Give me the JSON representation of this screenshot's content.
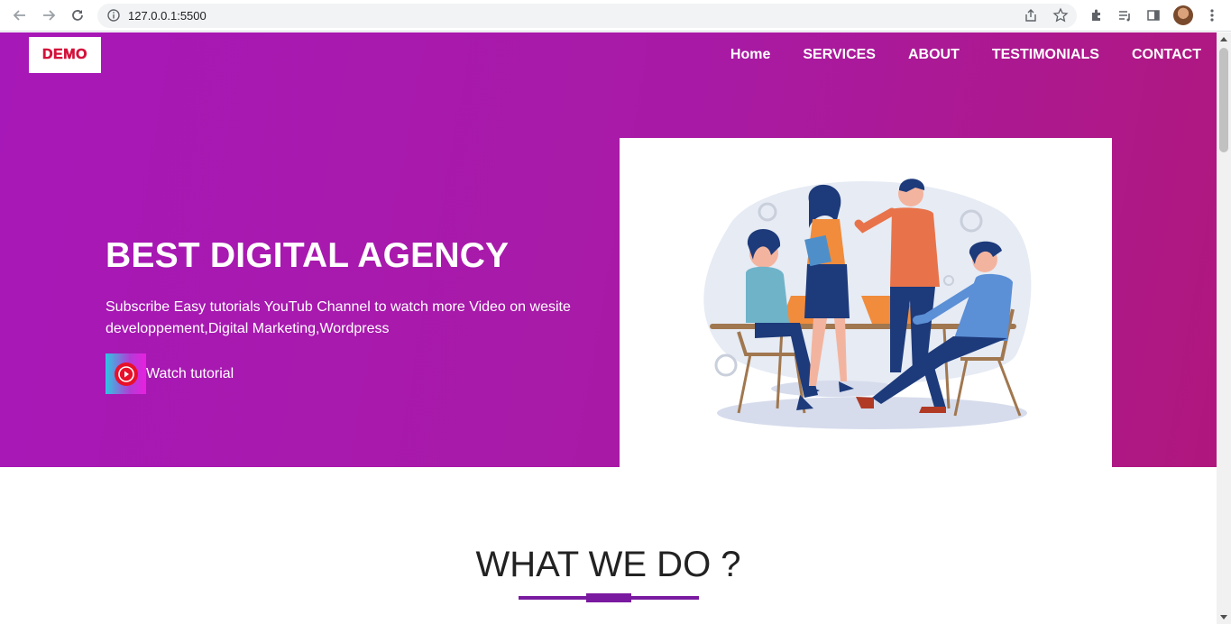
{
  "browser": {
    "url": "127.0.0.1:5500"
  },
  "page": {
    "logo_text": "DEMO",
    "nav": [
      {
        "label": "Home"
      },
      {
        "label": "SERVICES"
      },
      {
        "label": "ABOUT"
      },
      {
        "label": "TESTIMONIALS"
      },
      {
        "label": "CONTACT"
      }
    ],
    "hero": {
      "title": "BEST DIGITAL AGENCY",
      "text": "Subscribe Easy tutorials YouTub Channel to watch more Video on wesite developpement,Digital Marketing,Wordpress",
      "watch_label": "Watch tutorial"
    },
    "section": {
      "heading": "WHAT WE DO ?"
    }
  },
  "colors": {
    "hero_start": "#a718b8",
    "hero_end": "#b0177d",
    "accent": "#7a1aa0",
    "logo_red": "#d3113a"
  }
}
